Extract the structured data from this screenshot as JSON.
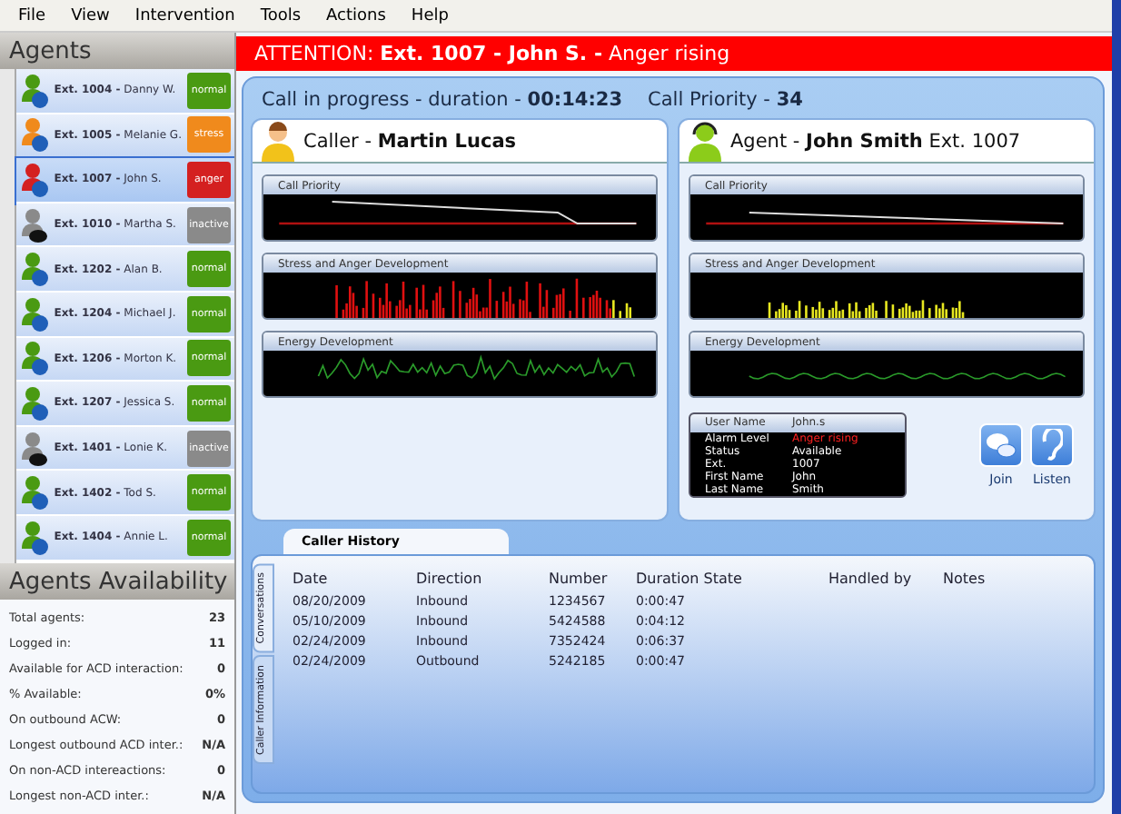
{
  "menu": [
    "File",
    "View",
    "Intervention",
    "Tools",
    "Actions",
    "Help"
  ],
  "agents": {
    "title": "Agents",
    "items": [
      {
        "ext": "Ext. 1004 -",
        "name": "Danny W.",
        "status": "normal",
        "color": "#4a9a12",
        "selected": false
      },
      {
        "ext": "Ext. 1005 -",
        "name": "Melanie G.",
        "status": "stress",
        "color": "#f08a1c",
        "selected": false
      },
      {
        "ext": "Ext. 1007 -",
        "name": "John S.",
        "status": "anger",
        "color": "#d42020",
        "selected": true
      },
      {
        "ext": "Ext. 1010 -",
        "name": "Martha S.",
        "status": "inactive",
        "color": "#8a8a8a",
        "selected": false
      },
      {
        "ext": "Ext. 1202 -",
        "name": "Alan B.",
        "status": "normal",
        "color": "#4a9a12",
        "selected": false
      },
      {
        "ext": "Ext. 1204 -",
        "name": "Michael J.",
        "status": "normal",
        "color": "#4a9a12",
        "selected": false
      },
      {
        "ext": "Ext. 1206 -",
        "name": "Morton K.",
        "status": "normal",
        "color": "#4a9a12",
        "selected": false
      },
      {
        "ext": "Ext. 1207 -",
        "name": "Jessica S.",
        "status": "normal",
        "color": "#4a9a12",
        "selected": false
      },
      {
        "ext": "Ext. 1401 -",
        "name": "Lonie K.",
        "status": "inactive",
        "color": "#8a8a8a",
        "selected": false
      },
      {
        "ext": "Ext. 1402 -",
        "name": "Tod S.",
        "status": "normal",
        "color": "#4a9a12",
        "selected": false
      },
      {
        "ext": "Ext. 1404 -",
        "name": "Annie L.",
        "status": "normal",
        "color": "#4a9a12",
        "selected": false
      }
    ]
  },
  "availability": {
    "title": "Agents Availability",
    "rows": [
      {
        "label": "Total agents:",
        "value": "23"
      },
      {
        "label": "Logged in:",
        "value": "11"
      },
      {
        "label": "Available for ACD interaction:",
        "value": "0"
      },
      {
        "label": "% Available:",
        "value": "0%"
      },
      {
        "label": "On outbound ACW:",
        "value": "0"
      },
      {
        "label": "Longest outbound ACD inter.:",
        "value": "N/A"
      },
      {
        "label": "On non-ACD intereactions:",
        "value": "0"
      },
      {
        "label": "Longest non-ACD inter.:",
        "value": "N/A"
      }
    ]
  },
  "attention": "ATTENTION: **Ext. 1007 - John S. -** Anger rising",
  "call": {
    "status": "Call in progress - duration - **00:14:23**",
    "priority": "Call Priority - **34**"
  },
  "caller": {
    "title": "Caller - **Martin Lucas**",
    "charts": [
      "Call Priority",
      "Stress and Anger Development",
      "Energy Development"
    ]
  },
  "agent": {
    "title": "Agent - **John Smith** Ext. 1007",
    "charts": [
      "Call Priority",
      "Stress and Anger Development",
      "Energy Development"
    ],
    "info": [
      {
        "label": "User Name",
        "value": "John.s",
        "alert": false
      },
      {
        "label": "Alarm Level",
        "value": "Anger rising",
        "alert": true
      },
      {
        "label": "Status",
        "value": "Available",
        "alert": false
      },
      {
        "label": "Ext.",
        "value": "1007",
        "alert": false
      },
      {
        "label": "First Name",
        "value": "John",
        "alert": false
      },
      {
        "label": "Last Name",
        "value": "Smith",
        "alert": false
      }
    ],
    "buttons": [
      {
        "kind": "join",
        "label": "Join"
      },
      {
        "kind": "listen",
        "label": "Listen"
      }
    ]
  },
  "history": {
    "tab": "Caller History",
    "side_tabs": [
      {
        "label": "Conversations",
        "selected": true
      },
      {
        "label": "Caller Information",
        "selected": false
      }
    ],
    "columns": [
      "Date",
      "Direction",
      "Number",
      "Duration State",
      "Handled by",
      "Notes"
    ],
    "rows": [
      [
        "08/20/2009",
        "Inbound",
        "1234567",
        "0:00:47"
      ],
      [
        "05/10/2009",
        "Inbound",
        "5424588",
        "0:04:12"
      ],
      [
        "02/24/2009",
        "Inbound",
        "7352424",
        "0:06:37"
      ],
      [
        "02/24/2009",
        "Outbound",
        "5242185",
        "0:00:47"
      ]
    ]
  }
}
